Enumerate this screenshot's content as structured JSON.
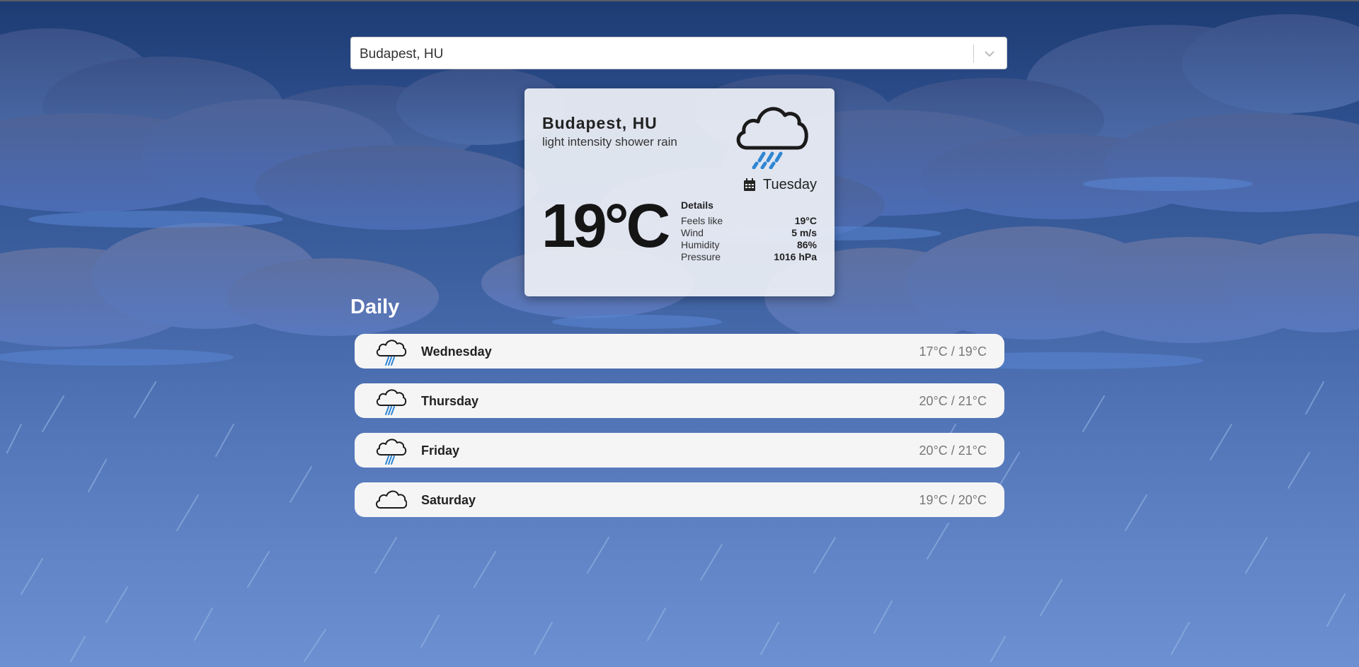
{
  "search": {
    "selected_value": "Budapest, HU",
    "dropdown_icon": "chevron-down-icon"
  },
  "current": {
    "city": "Budapest, HU",
    "description": "light intensity shower rain",
    "icon": "shower-rain-icon",
    "day_icon": "calendar-icon",
    "day": "Tuesday",
    "temperature": "19°C",
    "details": {
      "title": "Details",
      "feels_like_label": "Feels like",
      "feels_like_value": "19°C",
      "wind_label": "Wind",
      "wind_value": "5 m/s",
      "humidity_label": "Humidity",
      "humidity_value": "86%",
      "pressure_label": "Pressure",
      "pressure_value": "1016 hPa"
    }
  },
  "daily": {
    "title": "Daily",
    "items": [
      {
        "day": "Wednesday",
        "range": "17°C / 19°C",
        "icon": "shower-rain-icon"
      },
      {
        "day": "Thursday",
        "range": "20°C / 21°C",
        "icon": "shower-rain-icon"
      },
      {
        "day": "Friday",
        "range": "20°C / 21°C",
        "icon": "shower-rain-icon"
      },
      {
        "day": "Saturday",
        "range": "19°C / 20°C",
        "icon": "cloud-icon"
      }
    ]
  },
  "colors": {
    "background_top": "#1d3b73",
    "background_bottom": "#6c90d1",
    "rain_accent": "#2f86d3",
    "card_background": "#eceff5"
  }
}
